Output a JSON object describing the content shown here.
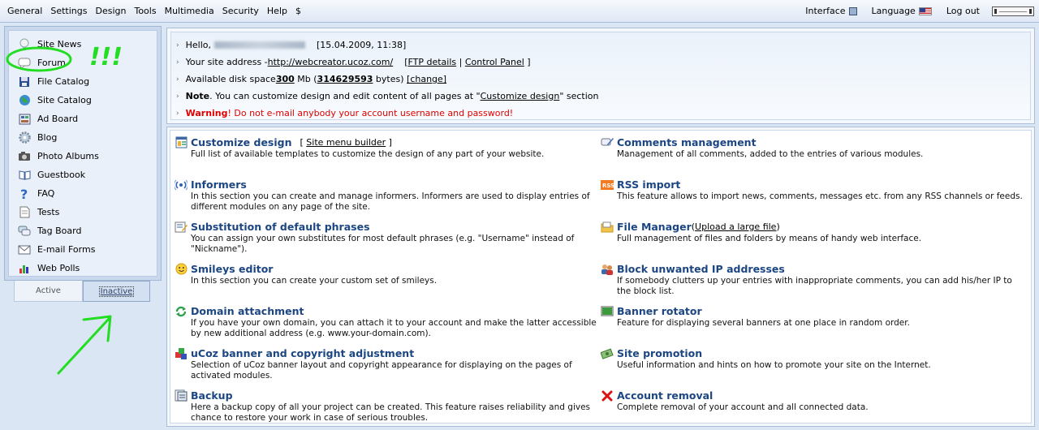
{
  "menu": {
    "items": [
      "General",
      "Settings",
      "Design",
      "Tools",
      "Multimedia",
      "Security",
      "Help",
      "$"
    ],
    "interface_label": "Interface",
    "language_label": "Language",
    "logout_label": "Log out"
  },
  "sidebar": {
    "items": [
      {
        "label": "Site News",
        "icon": "bulb-icon"
      },
      {
        "label": "Forum",
        "icon": "speech-bubble-icon"
      },
      {
        "label": "File Catalog",
        "icon": "floppy-icon"
      },
      {
        "label": "Site Catalog",
        "icon": "globe-icon"
      },
      {
        "label": "Ad Board",
        "icon": "notice-board-icon"
      },
      {
        "label": "Blog",
        "icon": "gear-icon"
      },
      {
        "label": "Photo Albums",
        "icon": "camera-icon"
      },
      {
        "label": "Guestbook",
        "icon": "book-icon"
      },
      {
        "label": "FAQ",
        "icon": "question-icon"
      },
      {
        "label": "Tests",
        "icon": "document-icon"
      },
      {
        "label": "Tag Board",
        "icon": "chat-icon"
      },
      {
        "label": "E-mail Forms",
        "icon": "mail-icon"
      },
      {
        "label": "Web Polls",
        "icon": "bar-chart-icon"
      }
    ],
    "tabs": {
      "active": "Active",
      "inactive": "Inactive"
    }
  },
  "annotation": {
    "text": "!!!",
    "color": "#22dd22"
  },
  "info": {
    "hello": "Hello,",
    "datetime": "[15.04.2009, 11:38]",
    "site_address_label": "Your site address - ",
    "site_address": "http://webcreator.ucoz.com/",
    "ftp_details": "FTP details",
    "control_panel": "Control Panel",
    "disk_label": "Available disk space ",
    "disk_mb": "300",
    "disk_mid": " Mb (",
    "disk_bytes": "314629593",
    "disk_end": " bytes) ",
    "change": "[change]",
    "note_bold": "Note",
    "note_text": ". You can customize design and edit content of all pages at \"",
    "note_link": "Customize design",
    "note_end": "\" section",
    "warning_bold": "Warning",
    "warning_text": "! Do not e-mail anybody your account username and password!"
  },
  "entries_left": [
    {
      "title": "Customize design",
      "extra": "[ Site menu builder ]",
      "desc": "Full list of available templates to customize the design of any part of your website.",
      "icon": "layout-icon"
    },
    {
      "title": "Informers",
      "extra": "",
      "desc": "In this section you can create and manage informers. Informers are used to display entries of different modules on any page of the site.",
      "icon": "broadcast-icon"
    },
    {
      "title": "Substitution of default phrases",
      "extra": "",
      "desc": "You can assign your own substitutes for most default phrases (e.g. \"Username\" instead of \"Nickname\").",
      "icon": "text-edit-icon"
    },
    {
      "title": "Smileys editor",
      "extra": "",
      "desc": "In this section you can create your custom set of smileys.",
      "icon": "smiley-icon"
    },
    {
      "title": "Domain attachment",
      "extra": "",
      "desc": "If you have your own domain, you can attach it to your account and make the latter accessible by new additional address (e.g. www.your-domain.com).",
      "icon": "refresh-icon"
    },
    {
      "title": "uCoz banner and copyright adjustment",
      "extra": "",
      "desc": "Selection of uCoz banner layout and copyright appearance for displaying on the pages of activated modules.",
      "icon": "cubes-icon"
    },
    {
      "title": "Backup",
      "extra": "",
      "desc": "Here a backup copy of all your project can be created. This feature raises reliability and gives chance to restore your work in case of serious troubles.",
      "icon": "backup-icon"
    }
  ],
  "entries_right": [
    {
      "title": "Comments management",
      "extra": "",
      "desc": "Management of all comments, added to the entries of various modules.",
      "icon": "comment-edit-icon"
    },
    {
      "title": "RSS import",
      "extra": "",
      "desc": "This feature allows to import news, comments, messages etc. from any RSS channels or feeds.",
      "icon": "rss-icon"
    },
    {
      "title": "File Manager",
      "extra": "(Upload a large file)",
      "desc": "Full management of files and folders by means of handy web interface.",
      "icon": "folder-icon"
    },
    {
      "title": "Block unwanted IP addresses",
      "extra": "",
      "desc": "If somebody clutters up your entries with inappropriate comments, you can add his/her IP to the block list.",
      "icon": "users-block-icon"
    },
    {
      "title": "Banner rotator",
      "extra": "",
      "desc": "Feature for displaying several banners at one place in random order.",
      "icon": "banner-icon"
    },
    {
      "title": "Site promotion",
      "extra": "",
      "desc": "Useful information and hints on how to promote your site on the Internet.",
      "icon": "money-icon"
    },
    {
      "title": "Account removal",
      "extra": "",
      "desc": "Complete removal of your account and all connected data.",
      "icon": "red-x-icon"
    }
  ]
}
